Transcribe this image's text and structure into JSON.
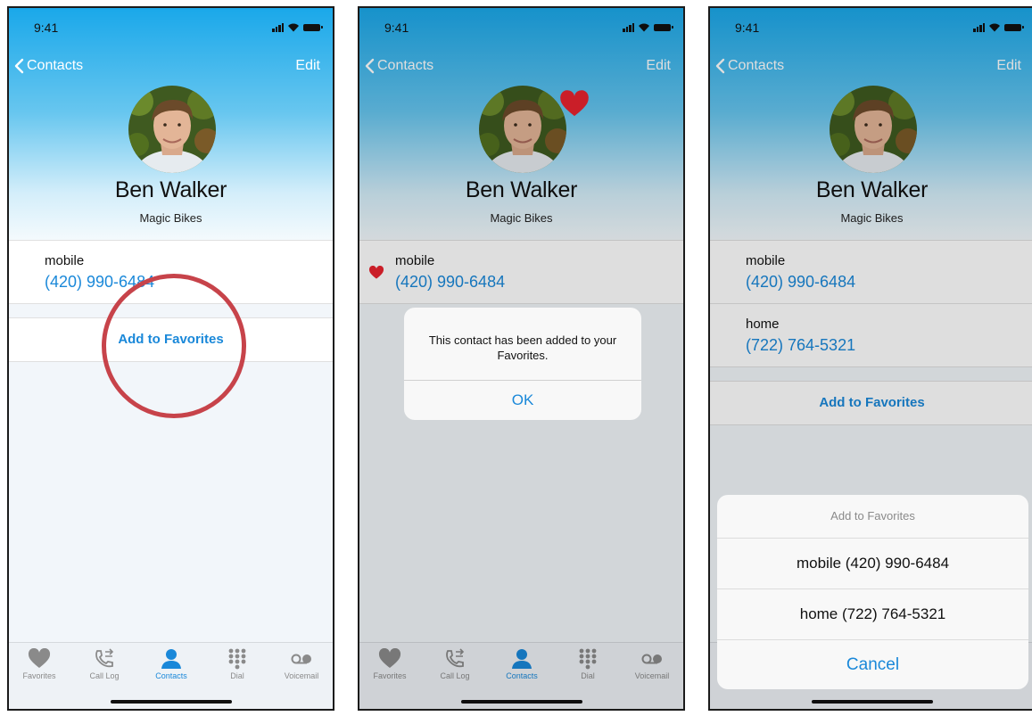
{
  "status": {
    "time": "9:41"
  },
  "nav": {
    "back_label": "Contacts",
    "edit_label": "Edit"
  },
  "contact": {
    "name": "Ben Walker",
    "company": "Magic Bikes"
  },
  "phones": [
    {
      "label": "mobile",
      "number": "(420) 990-6484"
    },
    {
      "label": "home",
      "number": "(722) 764-5321"
    }
  ],
  "action": {
    "add_favorites": "Add to Favorites"
  },
  "alert": {
    "message": "This contact has been added to your Favorites.",
    "ok": "OK"
  },
  "sheet": {
    "title": "Add to Favorites",
    "option_mobile": "mobile (420) 990-6484",
    "option_home": "home (722) 764-5321",
    "cancel": "Cancel"
  },
  "tabs": [
    {
      "label": "Favorites",
      "icon": "heart-icon"
    },
    {
      "label": "Call Log",
      "icon": "call-log-icon"
    },
    {
      "label": "Contacts",
      "icon": "person-icon"
    },
    {
      "label": "Dial",
      "icon": "keypad-icon"
    },
    {
      "label": "Voicemail",
      "icon": "voicemail-icon"
    }
  ],
  "active_tab": "Contacts",
  "colors": {
    "accent": "#1a88d9",
    "favorite": "#e8232f",
    "highlight_circle": "#c7434a"
  }
}
